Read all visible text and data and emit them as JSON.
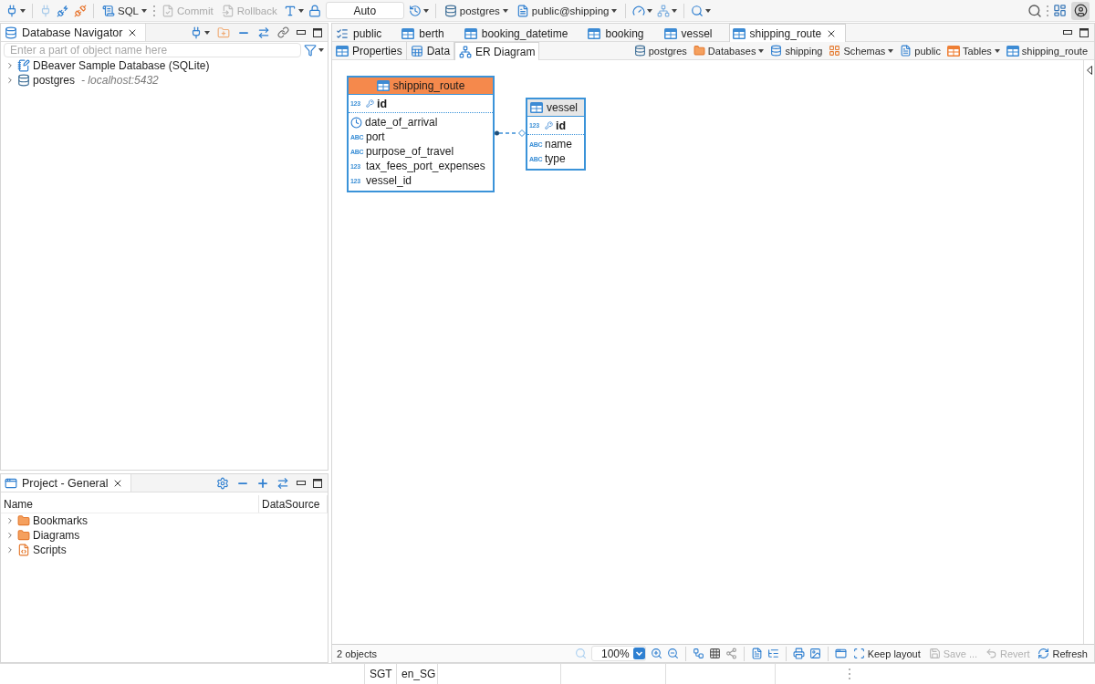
{
  "toolbar": {
    "sql_label": "SQL",
    "commit": {
      "label": "Commit",
      "disabled": true
    },
    "rollback": {
      "label": "Rollback",
      "disabled": true
    },
    "transaction_mode": "Auto",
    "connection": "postgres",
    "schema": "public@shipping"
  },
  "navigator": {
    "title": "Database Navigator",
    "filter": {
      "placeholder": "Enter a part of object name here"
    },
    "items": [
      {
        "kind": "sqlite",
        "label": "DBeaver Sample Database (SQLite)",
        "expanded": false
      },
      {
        "kind": "postgres",
        "label": "postgres",
        "detail": "- localhost:5432",
        "expanded": false
      }
    ]
  },
  "project": {
    "title": "Project - General",
    "columns": [
      "Name",
      "DataSource"
    ],
    "items": [
      {
        "kind": "bookmarks",
        "label": "Bookmarks",
        "expanded": false
      },
      {
        "kind": "diagrams",
        "label": "Diagrams",
        "expanded": false
      },
      {
        "kind": "scripts",
        "label": "Scripts",
        "expanded": false
      }
    ]
  },
  "editor": {
    "tabs": [
      {
        "kind": "schema",
        "label": "public",
        "selected": false
      },
      {
        "kind": "table",
        "label": "berth",
        "selected": false
      },
      {
        "kind": "table",
        "label": "booking_datetime",
        "selected": false
      },
      {
        "kind": "table",
        "label": "booking",
        "selected": false
      },
      {
        "kind": "table",
        "label": "vessel",
        "selected": false
      },
      {
        "kind": "table",
        "label": "shipping_route",
        "selected": true
      }
    ],
    "subtabs": [
      {
        "kind": "properties",
        "label": "Properties",
        "selected": false
      },
      {
        "kind": "data",
        "label": "Data",
        "selected": false
      },
      {
        "kind": "diagram",
        "label": "ER Diagram",
        "selected": true
      }
    ],
    "breadcrumbs": [
      {
        "kind": "connection",
        "label": "postgres",
        "dropdown": false
      },
      {
        "kind": "folder",
        "label": "Databases",
        "dropdown": true
      },
      {
        "kind": "database",
        "label": "shipping",
        "dropdown": false
      },
      {
        "kind": "schemas",
        "label": "Schemas",
        "dropdown": true
      },
      {
        "kind": "schema",
        "label": "public",
        "dropdown": false
      },
      {
        "kind": "tables",
        "label": "Tables",
        "dropdown": true
      },
      {
        "kind": "table",
        "label": "shipping_route",
        "dropdown": false
      }
    ],
    "diagram": {
      "entities": [
        {
          "name": "shipping_route",
          "highlighted": true,
          "keys": [
            {
              "kind": "key",
              "badge": "123",
              "name": "id"
            }
          ],
          "attributes": [
            {
              "kind": "datetime",
              "name": "date_of_arrival"
            },
            {
              "kind": "text",
              "badge": "ABC",
              "name": "port"
            },
            {
              "kind": "text",
              "badge": "ABC",
              "name": "purpose_of_travel"
            },
            {
              "kind": "number",
              "badge": "123",
              "name": "tax_fees_port_expenses"
            },
            {
              "kind": "number",
              "badge": "123",
              "name": "vessel_id"
            }
          ]
        },
        {
          "name": "vessel",
          "highlighted": false,
          "keys": [
            {
              "kind": "key",
              "badge": "123",
              "name": "id"
            }
          ],
          "attributes": [
            {
              "kind": "text",
              "badge": "ABC",
              "name": "name"
            },
            {
              "kind": "text",
              "badge": "ABC",
              "name": "type"
            }
          ]
        }
      ]
    },
    "status": {
      "objects": "2 objects",
      "zoom": "100%",
      "actions": [
        {
          "kind": "keep-layout",
          "label": "Keep layout",
          "disabled": false
        },
        {
          "kind": "save",
          "label": "Save ...",
          "disabled": true
        },
        {
          "kind": "revert",
          "label": "Revert",
          "disabled": true
        },
        {
          "kind": "refresh",
          "label": "Refresh",
          "disabled": false
        }
      ]
    }
  },
  "status_bar": {
    "cells": [
      "SGT",
      "en_SG"
    ]
  }
}
